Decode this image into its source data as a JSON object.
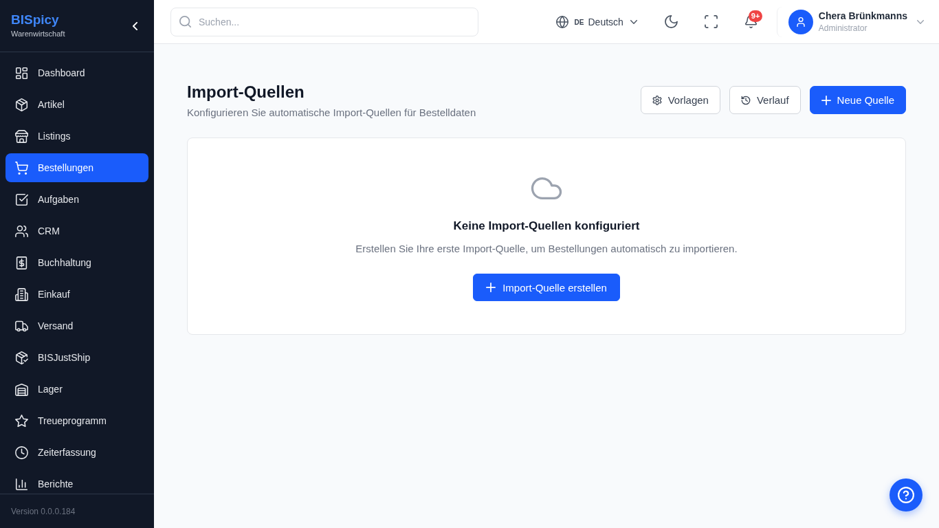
{
  "sidebar": {
    "brand": "BISpicy",
    "subtitle": "Warenwirtschaft",
    "items": [
      {
        "label": "Dashboard",
        "selected": false
      },
      {
        "label": "Artikel",
        "selected": false
      },
      {
        "label": "Listings",
        "selected": false
      },
      {
        "label": "Bestellungen",
        "selected": true
      },
      {
        "label": "Aufgaben",
        "selected": false
      },
      {
        "label": "CRM",
        "selected": false
      },
      {
        "label": "Buchhaltung",
        "selected": false
      },
      {
        "label": "Einkauf",
        "selected": false
      },
      {
        "label": "Versand",
        "selected": false
      },
      {
        "label": "BISJustShip",
        "selected": false
      },
      {
        "label": "Lager",
        "selected": false
      },
      {
        "label": "Treueprogramm",
        "selected": false
      },
      {
        "label": "Zeiterfassung",
        "selected": false
      },
      {
        "label": "Berichte",
        "selected": false
      }
    ],
    "version": "Version 0.0.0.184"
  },
  "topbar": {
    "search": {
      "placeholder": "Suchen..."
    },
    "language": {
      "code": "DE",
      "label": "Deutsch"
    },
    "notifications": {
      "badge": "9+"
    },
    "user": {
      "name": "Chera Brünkmanns",
      "role": "Administrator"
    }
  },
  "page": {
    "title": "Import-Quellen",
    "subtitle": "Konfigurieren Sie automatische Import-Quellen für Bestelldaten",
    "actions": [
      {
        "label": "Vorlagen",
        "kind": "secondary"
      },
      {
        "label": "Verlauf",
        "kind": "secondary"
      },
      {
        "label": "Neue Quelle",
        "kind": "primary"
      }
    ]
  },
  "empty_state": {
    "title": "Keine Import-Quellen konfiguriert",
    "text": "Erstellen Sie Ihre erste Import-Quelle, um Bestellungen automatisch zu importieren.",
    "button": "Import-Quelle erstellen"
  }
}
